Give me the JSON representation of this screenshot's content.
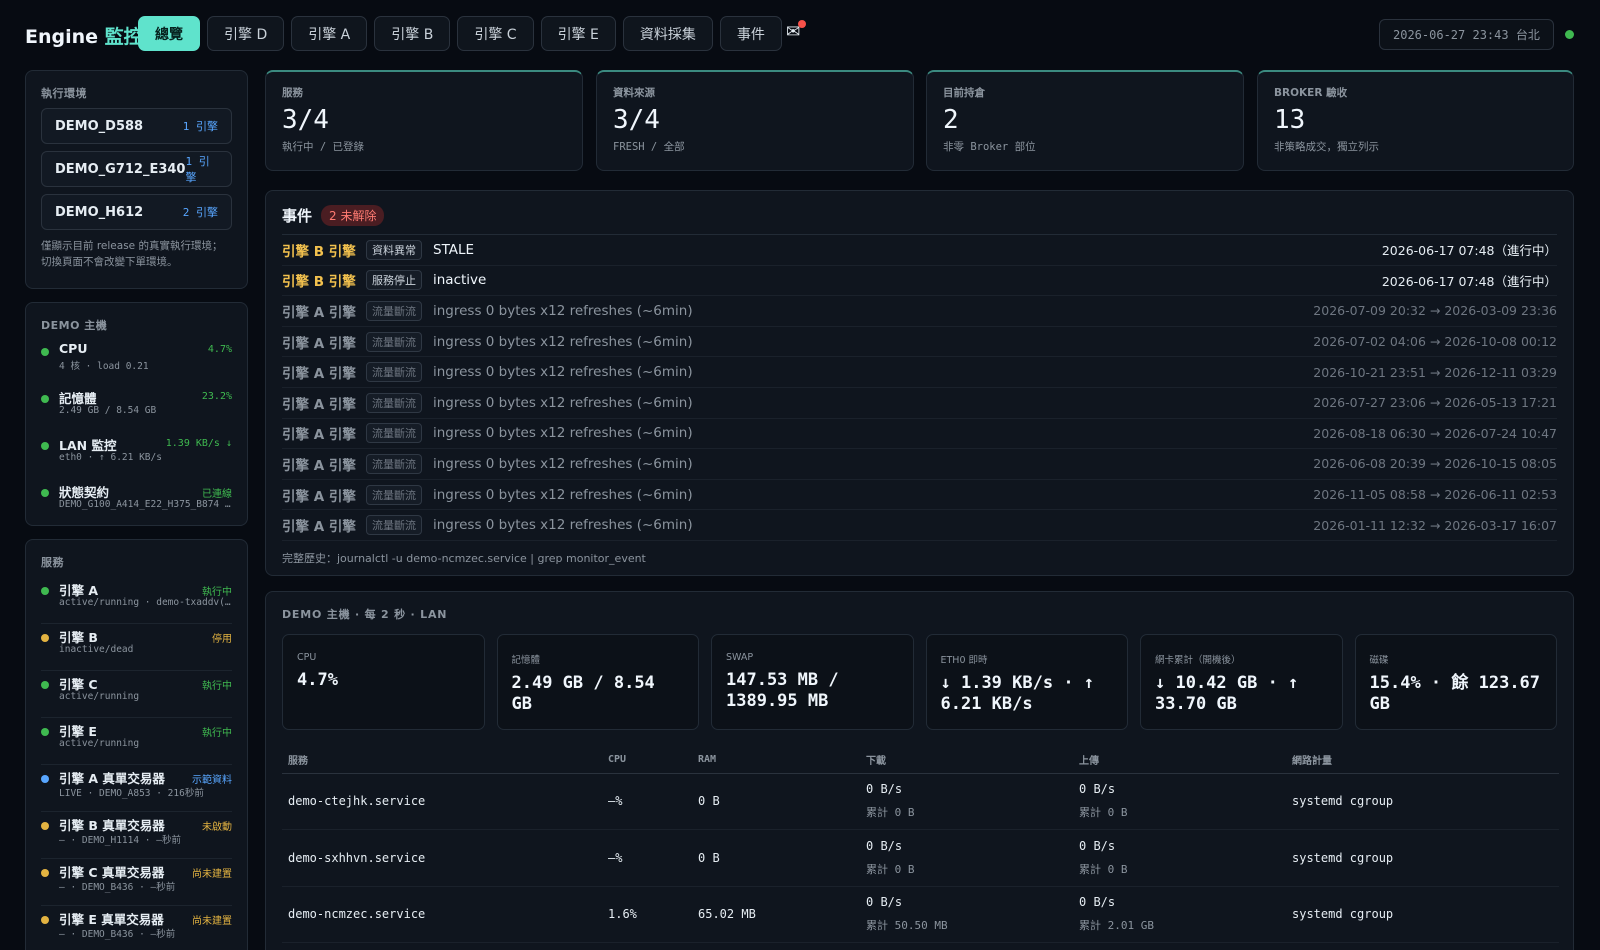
{
  "header": {
    "brand_prefix": "Engine",
    "brand_accent": "監控",
    "tabs": [
      {
        "label": "總覽",
        "active": true
      },
      {
        "label": "引擎 D"
      },
      {
        "label": "引擎 A"
      },
      {
        "label": "引擎 B"
      },
      {
        "label": "引擎 C"
      },
      {
        "label": "引擎 E"
      },
      {
        "label": "資料採集"
      },
      {
        "label": "事件"
      }
    ],
    "mail_icon": "✉",
    "clock": "2026-06-27 23:43 台北"
  },
  "environments": {
    "title": "執行環境",
    "items": [
      {
        "name": "DEMO_D588",
        "count": "1 引擎"
      },
      {
        "name": "DEMO_G712_E340",
        "count": "1 引擎"
      },
      {
        "name": "DEMO_H612",
        "count": "2 引擎"
      }
    ],
    "note": "僅顯示目前 release 的真實執行環境；切換頁面不會改變下單環境。"
  },
  "host": {
    "title": "DEMO 主機",
    "metrics": [
      {
        "name": "CPU",
        "sub": "4 核 · load 0.21",
        "value": "4.7%",
        "color": "#3fb950"
      },
      {
        "name": "記憶體",
        "sub": "2.49 GB / 8.54 GB",
        "value": "23.2%",
        "color": "#3fb950"
      },
      {
        "name": "LAN 監控",
        "sub": "eth0 · ↑ 6.21 KB/s",
        "value": "1.39 KB/s ↓",
        "color": "#3fb950"
      },
      {
        "name": "狀態契約",
        "sub": "DEMO_G100_A414_E22_H375_B874 …",
        "value": "已連線",
        "color": "#3fb950"
      }
    ]
  },
  "services_sidebar": {
    "title": "服務",
    "items": [
      {
        "name": "引擎 A",
        "sub": "active/running · demo-txaddv(…",
        "status": "執行中",
        "color": "#3fb950"
      },
      {
        "name": "引擎 B",
        "sub": "inactive/dead",
        "status": "停用",
        "color": "#e3b341"
      },
      {
        "name": "引擎 C",
        "sub": "active/running",
        "status": "執行中",
        "color": "#3fb950"
      },
      {
        "name": "引擎 E",
        "sub": "active/running",
        "status": "執行中",
        "color": "#3fb950"
      },
      {
        "name": "引擎 A 真單交易器",
        "sub": "LIVE · DEMO_A853 · 216秒前",
        "status": "示範資料",
        "color": "#58a6ff"
      },
      {
        "name": "引擎 B 真單交易器",
        "sub": "— · DEMO_H1114 · —秒前",
        "status": "未啟動",
        "color": "#e3b341"
      },
      {
        "name": "引擎 C 真單交易器",
        "sub": "— · DEMO_B436 · —秒前",
        "status": "尚未建置",
        "color": "#e3b341"
      },
      {
        "name": "引擎 E 真單交易器",
        "sub": "— · DEMO_B436 · —秒前",
        "status": "尚未建置",
        "color": "#e3b341"
      }
    ]
  },
  "stats": [
    {
      "label": "服務",
      "value": "3/4",
      "sub": "執行中 / 已登錄"
    },
    {
      "label": "資料來源",
      "value": "3/4",
      "sub": "FRESH / 全部"
    },
    {
      "label": "目前持倉",
      "value": "2",
      "sub": "非零 Broker 部位"
    },
    {
      "label": "BROKER 驗收",
      "value": "13",
      "sub": "非策略成交，獨立列示"
    }
  ],
  "events": {
    "title": "事件",
    "badge": "2 未解除",
    "rows": [
      {
        "engine": "引擎 B 引擎",
        "tag": "資料異常",
        "msg": "STALE",
        "time": "2026-06-17 07:48（進行中）",
        "active": true
      },
      {
        "engine": "引擎 B 引擎",
        "tag": "服務停止",
        "msg": "inactive",
        "time": "2026-06-17 07:48（進行中）",
        "active": true
      },
      {
        "engine": "引擎 A 引擎",
        "tag": "流量斷流",
        "msg": "ingress 0 bytes x12 refreshes (~6min)",
        "time": "2026-07-09 20:32 → 2026-03-09 23:36"
      },
      {
        "engine": "引擎 A 引擎",
        "tag": "流量斷流",
        "msg": "ingress 0 bytes x12 refreshes (~6min)",
        "time": "2026-07-02 04:06 → 2026-10-08 00:12"
      },
      {
        "engine": "引擎 A 引擎",
        "tag": "流量斷流",
        "msg": "ingress 0 bytes x12 refreshes (~6min)",
        "time": "2026-10-21 23:51 → 2026-12-11 03:29"
      },
      {
        "engine": "引擎 A 引擎",
        "tag": "流量斷流",
        "msg": "ingress 0 bytes x12 refreshes (~6min)",
        "time": "2026-07-27 23:06 → 2026-05-13 17:21"
      },
      {
        "engine": "引擎 A 引擎",
        "tag": "流量斷流",
        "msg": "ingress 0 bytes x12 refreshes (~6min)",
        "time": "2026-08-18 06:30 → 2026-07-24 10:47"
      },
      {
        "engine": "引擎 A 引擎",
        "tag": "流量斷流",
        "msg": "ingress 0 bytes x12 refreshes (~6min)",
        "time": "2026-06-08 20:39 → 2026-10-15 08:05"
      },
      {
        "engine": "引擎 A 引擎",
        "tag": "流量斷流",
        "msg": "ingress 0 bytes x12 refreshes (~6min)",
        "time": "2026-11-05 08:58 → 2026-06-11 02:53"
      },
      {
        "engine": "引擎 A 引擎",
        "tag": "流量斷流",
        "msg": "ingress 0 bytes x12 refreshes (~6min)",
        "time": "2026-01-11 12:32 → 2026-03-17 16:07"
      }
    ],
    "footer": "完整歷史：journalctl -u demo-ncmzec.service | grep monitor_event"
  },
  "host_detail": {
    "title": "DEMO 主機 · 每 2 秒 · LAN",
    "cards": [
      {
        "label": "CPU",
        "value": "4.7%"
      },
      {
        "label": "記憶體",
        "value": "2.49 GB / 8.54 GB"
      },
      {
        "label": "SWAP",
        "value": "147.53 MB / 1389.95 MB"
      },
      {
        "label": "ETH0 即時",
        "value": "↓ 1.39 KB/s · ↑ 6.21 KB/s"
      },
      {
        "label": "網卡累計（開機後）",
        "value": "↓ 10.42 GB · ↑ 33.70 GB"
      },
      {
        "label": "磁碟",
        "value": "15.4% · 餘 123.67 GB"
      }
    ],
    "table": {
      "columns": [
        "服務",
        "CPU",
        "RAM",
        "下載",
        "上傳",
        "網路計量"
      ],
      "rows": [
        {
          "service": "demo-ctejhk.service",
          "cpu": "—%",
          "ram": "0 B",
          "down": "0 B/s",
          "down_total": "累計 0 B",
          "up": "0 B/s",
          "up_total": "累計 0 B",
          "meter": "systemd cgroup"
        },
        {
          "service": "demo-sxhhvn.service",
          "cpu": "—%",
          "ram": "0 B",
          "down": "0 B/s",
          "down_total": "累計 0 B",
          "up": "0 B/s",
          "up_total": "累計 0 B",
          "meter": "systemd cgroup"
        },
        {
          "service": "demo-ncmzec.service",
          "cpu": "1.6%",
          "ram": "65.02 MB",
          "down": "0 B/s",
          "down_total": "累計 50.50 MB",
          "up": "0 B/s",
          "up_total": "累計 2.01 GB",
          "meter": "systemd cgroup"
        }
      ]
    }
  }
}
